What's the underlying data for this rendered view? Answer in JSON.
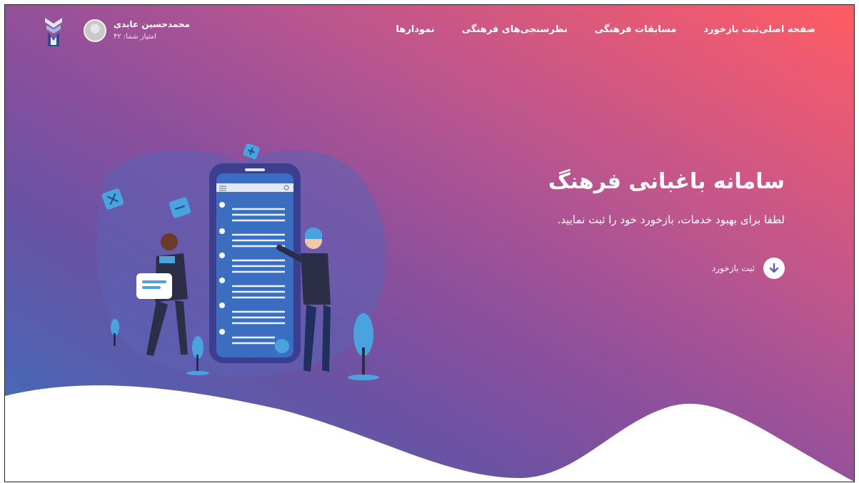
{
  "nav": {
    "items": [
      "صفحه اصلی",
      "ثبت بازخورد",
      "مسابقات فرهنگی",
      "نظرسنجی‌های فرهنگی",
      "نمودارها"
    ]
  },
  "user": {
    "name": "محمدحسین عابدی",
    "score_label": "امتیاز شما:",
    "score": "۴۲"
  },
  "hero": {
    "title": "سامانه باغبانی فرهنگ",
    "subtitle": "لطفا برای بهبود خدمات، بازخورد خود را ثبت نمایید.",
    "cta_label": "ثبت بازخورد"
  },
  "icons": {
    "logo": "university-logo-icon",
    "avatar": "user-avatar-icon",
    "cta": "arrow-down-circle-icon",
    "menu": "hamburger-icon",
    "search": "search-icon"
  },
  "colors": {
    "gradient_start": "#ff5c61",
    "gradient_mid": "#8a4f9d",
    "gradient_end": "#3e7ec4",
    "phone": "#3c3f8f",
    "accent": "#4aa3df"
  }
}
